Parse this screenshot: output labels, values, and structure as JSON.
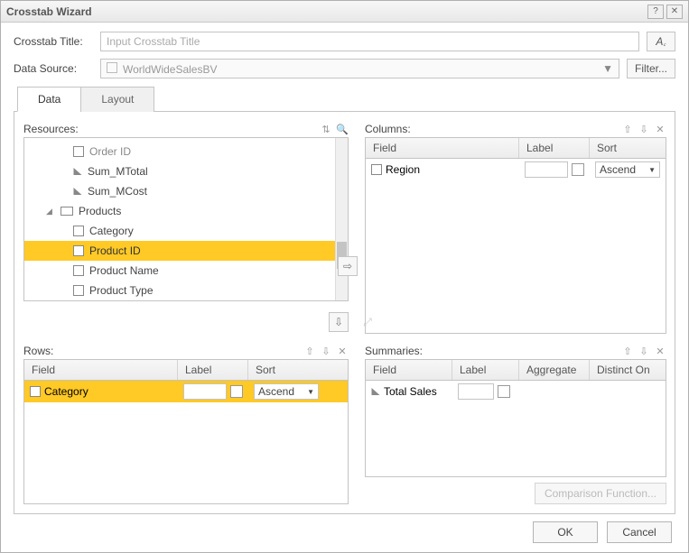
{
  "window": {
    "title": "Crosstab Wizard"
  },
  "form": {
    "title_label": "Crosstab Title:",
    "title_placeholder": "Input Crosstab Title",
    "font_btn": "A",
    "ds_label": "Data Source:",
    "ds_value": "WorldWideSalesBV",
    "filter_btn": "Filter..."
  },
  "tabs": {
    "data": "Data",
    "layout": "Layout",
    "active": "Data"
  },
  "resources": {
    "title": "Resources:",
    "items": [
      {
        "label": "Order ID",
        "icon": "box",
        "level": 2
      },
      {
        "label": "Sum_MTotal",
        "icon": "tri",
        "level": 2
      },
      {
        "label": "Sum_MCost",
        "icon": "tri",
        "level": 2
      },
      {
        "label": "Products",
        "icon": "folder",
        "level": 1,
        "expanded": true
      },
      {
        "label": "Category",
        "icon": "box",
        "level": 2
      },
      {
        "label": "Product ID",
        "icon": "box",
        "level": 2,
        "selected": true
      },
      {
        "label": "Product Name",
        "icon": "box",
        "level": 2
      },
      {
        "label": "Product Type",
        "icon": "box",
        "level": 2
      }
    ]
  },
  "columns": {
    "title": "Columns:",
    "headers": {
      "field": "Field",
      "label": "Label",
      "sort": "Sort"
    },
    "rows": [
      {
        "field": "Region",
        "icon": "box",
        "sort": "Ascend"
      }
    ]
  },
  "rows_panel": {
    "title": "Rows:",
    "headers": {
      "field": "Field",
      "label": "Label",
      "sort": "Sort"
    },
    "rows": [
      {
        "field": "Category",
        "icon": "box",
        "sort": "Ascend",
        "selected": true
      }
    ]
  },
  "summaries": {
    "title": "Summaries:",
    "headers": {
      "field": "Field",
      "label": "Label",
      "aggregate": "Aggregate",
      "distinct": "Distinct On"
    },
    "rows": [
      {
        "field": "Total Sales",
        "icon": "tri"
      }
    ]
  },
  "comparison_btn": "Comparison Function...",
  "footer": {
    "ok": "OK",
    "cancel": "Cancel"
  }
}
